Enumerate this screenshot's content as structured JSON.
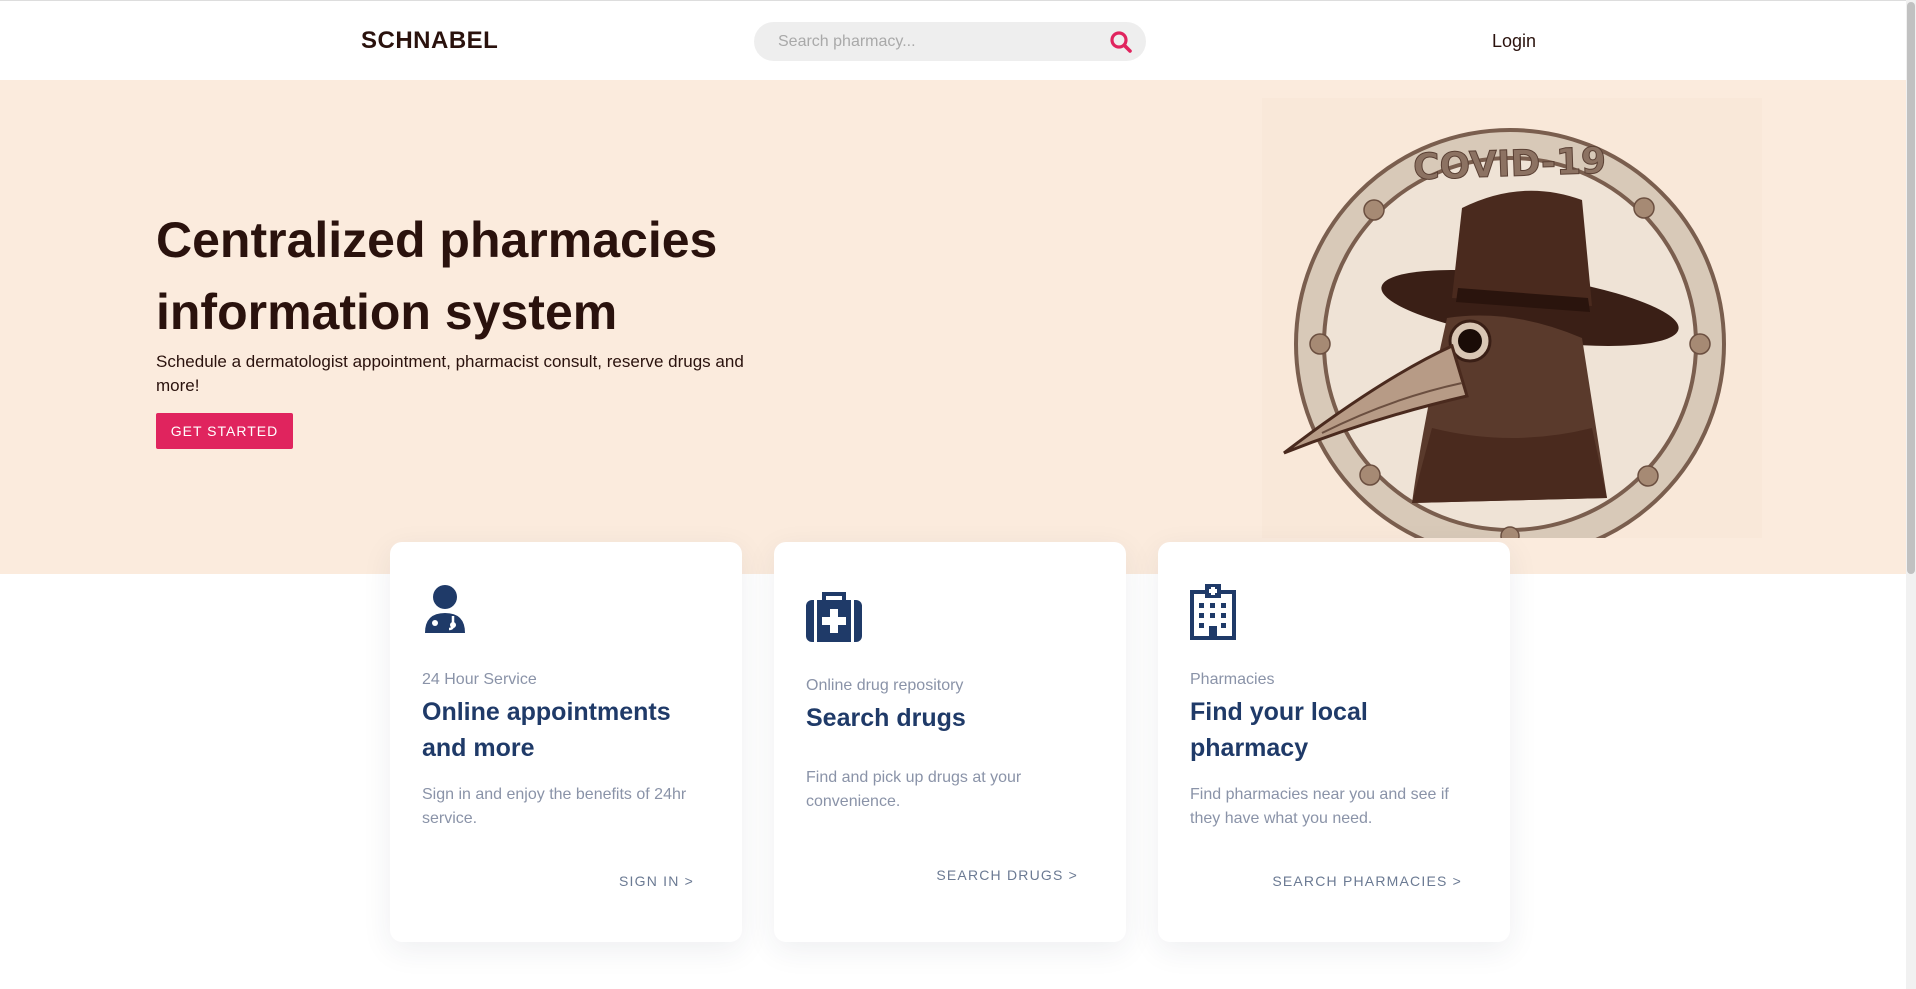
{
  "header": {
    "brand": "SCHNABEL",
    "search_placeholder": "Search pharmacy...",
    "login_label": "Login"
  },
  "hero": {
    "title": "Centralized pharmacies information system",
    "subtitle": "Schedule a dermatologist appointment, pharmacist consult, reserve drugs and more!",
    "cta_label": "GET STARTED",
    "emblem_text": "COVID-19"
  },
  "cards": [
    {
      "icon": "doctor-icon",
      "kicker": "24 Hour Service",
      "title": "Online appointments and more",
      "description": "Sign in and enjoy the benefits of 24hr service.",
      "link": "SIGN IN >"
    },
    {
      "icon": "medical-kit-icon",
      "kicker": "Online drug repository",
      "title": "Search drugs",
      "description": "Find and pick up drugs at your convenience.",
      "link": "SEARCH DRUGS >"
    },
    {
      "icon": "hospital-building-icon",
      "kicker": "Pharmacies",
      "title": "Find your local pharmacy",
      "description": "Find pharmacies near you and see if they have what you need.",
      "link": "SEARCH PHARMACIES >"
    }
  ],
  "colors": {
    "accent": "#e0245e",
    "hero_bg": "#fbebdd",
    "card_title": "#1f3a68",
    "text_dark": "#2a120d"
  }
}
